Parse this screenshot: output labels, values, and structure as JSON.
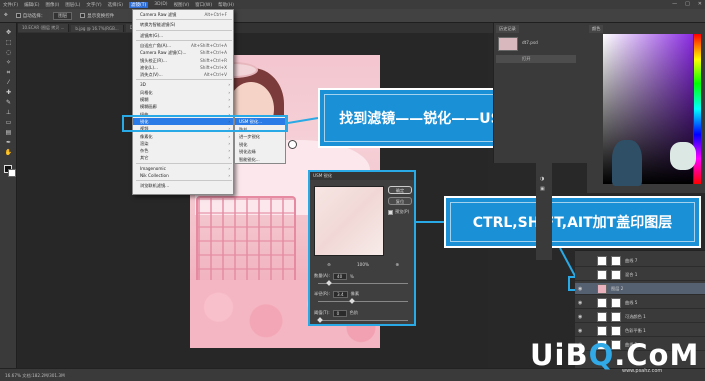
{
  "menubar": {
    "items": [
      "文件(F)",
      "编辑(E)",
      "图像(I)",
      "图层(L)",
      "文字(Y)",
      "选择(S)",
      "滤镜(T)",
      "3D(D)",
      "视图(V)",
      "窗口(W)",
      "帮助(H)"
    ],
    "active_index": 6,
    "window_buttons": [
      "—",
      "□",
      "✕"
    ]
  },
  "options_bar": {
    "auto_select_label": "自动选择：",
    "target_value": "图层",
    "show_transform_label": "显示变换控件"
  },
  "doc_tabs": [
    "10.ECAR (图层 拷贝 ...",
    "b.jpg @ 16.7%(RGB...",
    "DBR 卓胜智...",
    "...g.jpg @ 43.8% (背景..."
  ],
  "filter_menu": {
    "items": [
      {
        "label": "Camera Raw 滤镜",
        "shortcut": "Alt+Ctrl+F",
        "submenu": false
      },
      {
        "label": "转换为智能滤镜(S)",
        "shortcut": "",
        "submenu": false
      },
      {
        "label": "滤镜库(G)...",
        "shortcut": "",
        "submenu": false
      },
      {
        "label": "自适应广角(A)...",
        "shortcut": "Alt+Shift+Ctrl+A",
        "submenu": false
      },
      {
        "label": "Camera Raw 滤镜(C)...",
        "shortcut": "Shift+Ctrl+A",
        "submenu": false
      },
      {
        "label": "镜头校正(R)...",
        "shortcut": "Shift+Ctrl+R",
        "submenu": false
      },
      {
        "label": "液化(L)...",
        "shortcut": "Shift+Ctrl+X",
        "submenu": false
      },
      {
        "label": "消失点(V)...",
        "shortcut": "Alt+Ctrl+V",
        "submenu": false
      },
      {
        "label": "3D",
        "shortcut": "",
        "submenu": true
      },
      {
        "label": "风格化",
        "shortcut": "",
        "submenu": true
      },
      {
        "label": "模糊",
        "shortcut": "",
        "submenu": true
      },
      {
        "label": "模糊画廊",
        "shortcut": "",
        "submenu": true
      },
      {
        "label": "扭曲",
        "shortcut": "",
        "submenu": true
      },
      {
        "label": "锐化",
        "shortcut": "",
        "submenu": true
      },
      {
        "label": "视频",
        "shortcut": "",
        "submenu": true
      },
      {
        "label": "像素化",
        "shortcut": "",
        "submenu": true
      },
      {
        "label": "渲染",
        "shortcut": "",
        "submenu": true
      },
      {
        "label": "杂色",
        "shortcut": "",
        "submenu": true
      },
      {
        "label": "其它",
        "shortcut": "",
        "submenu": true
      },
      {
        "label": "Imagenomic",
        "shortcut": "",
        "submenu": true
      },
      {
        "label": "Nik Collection",
        "shortcut": "",
        "submenu": true
      },
      {
        "label": "浏览联机滤镜...",
        "shortcut": "",
        "submenu": false
      }
    ],
    "highlighted_index": 13
  },
  "sharpen_submenu": {
    "items": [
      "USM 锐化...",
      "防抖...",
      "进一步锐化",
      "锐化",
      "锐化边缘",
      "智能锐化..."
    ],
    "highlighted_index": 0
  },
  "callouts": {
    "usm": "找到滤镜——锐化——USM锐化",
    "stamp": "CTRL,SHIFT,AIT加T盖印图层"
  },
  "usm_dialog": {
    "title": "USM 锐化",
    "ok_label": "确定",
    "reset_label": "复位",
    "preview_label": "预览(P)",
    "zoom_value": "100%",
    "amount_label": "数量(A):",
    "amount_value": "40",
    "amount_unit": "%",
    "radius_label": "半径(R):",
    "radius_value": "3.4",
    "radius_unit": "像素",
    "threshold_label": "阈值(T):",
    "threshold_value": "0",
    "threshold_unit": "色阶",
    "amount_level": 0.1,
    "radius_level": 0.35,
    "threshold_level": 0.0
  },
  "history_panel": {
    "tabs": [
      "历史记录"
    ],
    "items": [
      "dt7.psd",
      "打开"
    ]
  },
  "color_panel": {
    "tabs": [
      "颜色"
    ]
  },
  "layers": [
    {
      "name": "曲线 7",
      "visible": false,
      "selected": false,
      "thumb": "adjust"
    },
    {
      "name": "混合 1",
      "visible": false,
      "selected": false,
      "thumb": "adjust"
    },
    {
      "name": "图层 2",
      "visible": true,
      "selected": true,
      "thumb": "photo"
    },
    {
      "name": "曲线 5",
      "visible": true,
      "selected": false,
      "thumb": "adjust"
    },
    {
      "name": "可选颜色 1",
      "visible": true,
      "selected": false,
      "thumb": "adjust"
    },
    {
      "name": "色彩平衡 1",
      "visible": true,
      "selected": false,
      "thumb": "adjust"
    },
    {
      "name": "曲线 1",
      "visible": true,
      "selected": false,
      "thumb": "adjust"
    }
  ],
  "statusbar": {
    "text": "16.67%    文档:182.2M/301.3M"
  },
  "watermark": {
    "logo_prefix": "UiB",
    "logo_accent": "Q",
    "logo_suffix": ".CoM",
    "url": "www.psahz.com"
  },
  "colors": {
    "accent": "#2b7be6",
    "callout_bg": "#1a90d6",
    "highlight_border": "#29a9e5"
  }
}
